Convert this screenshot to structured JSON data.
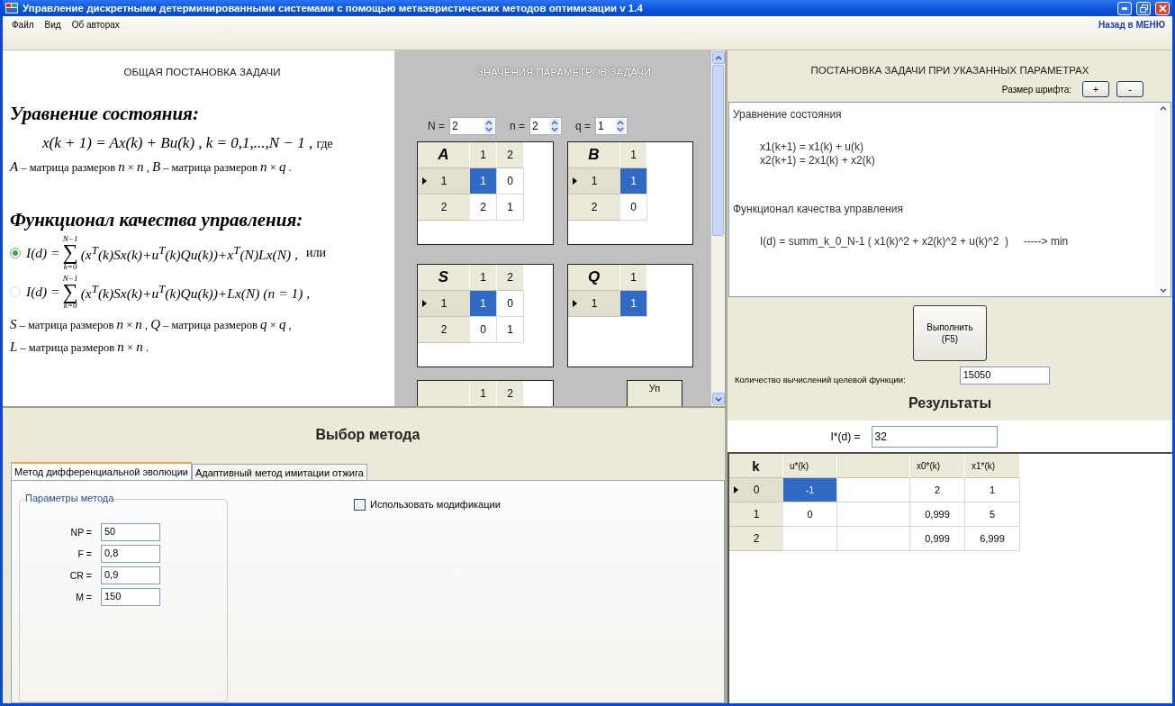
{
  "window": {
    "title": "Управление дискретными детерминированными системами с помощью метаэвристических методов оптимизации v 1.4"
  },
  "menu": {
    "items": [
      "Файл",
      "Вид",
      "Об авторах"
    ],
    "back_link": "Назад в МЕНЮ"
  },
  "general_statement": {
    "title": "ОБЩАЯ ПОСТАНОВКА ЗАДАЧИ",
    "state_heading": "Уравнение состояния:",
    "state_equation": "x(k + 1) = Ax(k) + Bu(k) ,  k = 0,1,...,N − 1 ,",
    "state_suffix": "где",
    "state_note": "*A* – матрица размеров *n* × *n* ,  *B* – матрица размеров *n* × *q* .",
    "functional_heading": "Функционал качества управления:",
    "functional_options": [
      {
        "selected": true,
        "prefix": "I(d) =",
        "upper": "N−1",
        "symbol": "∑",
        "lower": "k=0",
        "body": "(x$^{T}$(k)Sx(k)+u$^{T}$(k)Qu(k))+x$^{T}$(N)Lx(N) ,",
        "suffix": "или"
      },
      {
        "selected": false,
        "prefix": "I(d) =",
        "upper": "N−1",
        "symbol": "∑",
        "lower": "k=0",
        "body": "(x$^{T}$(k)Sx(k)+u$^{T}$(k)Qu(k))+Lx(N)   (n = 1) ,"
      }
    ],
    "notes": [
      "*S* – матрица размеров *n* × *n* ,  *Q* – матрица размеров *q* × *q* ,",
      "*L* – матрица размеров *n* × *n* ."
    ]
  },
  "parameters": {
    "title": "ЗНАЧЕНИЯ ПАРАМЕТРОВ ЗАДАЧИ",
    "spinners": [
      {
        "label": "N =",
        "value": "2"
      },
      {
        "label": "n =",
        "value": "2"
      },
      {
        "label": "q =",
        "value": "1"
      }
    ],
    "matrices": [
      {
        "name": "A",
        "columns": [
          "1",
          "2"
        ],
        "rows": [
          {
            "label": "1",
            "current": true,
            "cells": [
              {
                "value": "1",
                "selected": true
              },
              {
                "value": "0",
                "selected": false
              }
            ]
          },
          {
            "label": "2",
            "current": false,
            "cells": [
              {
                "value": "2",
                "selected": false
              },
              {
                "value": "1",
                "selected": false
              }
            ]
          }
        ]
      },
      {
        "name": "B",
        "columns": [
          "1"
        ],
        "rows": [
          {
            "label": "1",
            "current": true,
            "cells": [
              {
                "value": "1",
                "selected": true
              }
            ]
          },
          {
            "label": "2",
            "current": false,
            "cells": [
              {
                "value": "0",
                "selected": false
              }
            ]
          }
        ]
      },
      {
        "name": "S",
        "columns": [
          "1",
          "2"
        ],
        "rows": [
          {
            "label": "1",
            "current": true,
            "cells": [
              {
                "value": "1",
                "selected": true
              },
              {
                "value": "0",
                "selected": false
              }
            ]
          },
          {
            "label": "2",
            "current": false,
            "cells": [
              {
                "value": "0",
                "selected": false
              },
              {
                "value": "1",
                "selected": false
              }
            ]
          }
        ]
      },
      {
        "name": "Q",
        "columns": [
          "1"
        ],
        "rows": [
          {
            "label": "1",
            "current": true,
            "cells": [
              {
                "value": "1",
                "selected": true
              }
            ]
          }
        ]
      }
    ],
    "partial_matrix": {
      "columns": [
        "1",
        "2"
      ]
    },
    "partial_button": "Уп"
  },
  "specific_statement": {
    "title": "ПОСТАНОВКА ЗАДАЧИ ПРИ УКАЗАННЫХ ПАРАМЕТРАХ",
    "font_size_label": "Размер шрифта:",
    "font_buttons": [
      "+",
      "-"
    ],
    "lines": [
      {
        "kind": "heading",
        "text": "Уравнение состояния"
      },
      {
        "kind": "formula",
        "text": "x1(k+1) = x1(k) + u(k)"
      },
      {
        "kind": "formula",
        "text": "x2(k+1) = 2x1(k) + x2(k)"
      },
      {
        "kind": "heading",
        "text": "Функционал качества управления"
      },
      {
        "kind": "formula",
        "text": "I(d) = summ_k_0_N-1 ( x1(k)^2 + x2(k)^2 + u(k)^2  )     -----> min"
      }
    ]
  },
  "run_button": {
    "lines": [
      "Выполнить",
      "(F5)"
    ]
  },
  "evaluations": {
    "label": "Количество вычислений целевой функции:",
    "value": "15050"
  },
  "results": {
    "title": "Результаты",
    "objective_label": "I*(d) =",
    "objective_value": "32",
    "columns": [
      {
        "label": "k"
      },
      {
        "label": "u*(k)"
      },
      {},
      {
        "label": "x0*(k)"
      },
      {
        "label": "x1*(k)"
      }
    ],
    "rows": [
      {
        "current": true,
        "cells": [
          {
            "value": "0"
          },
          {
            "value": "-1",
            "selected": true
          },
          {
            "selected": false
          },
          {
            "value": "2",
            "selected": false
          },
          {
            "value": "1",
            "selected": false
          }
        ]
      },
      {
        "current": false,
        "cells": [
          {
            "value": "1"
          },
          {
            "value": "0",
            "selected": false
          },
          {
            "selected": false
          },
          {
            "value": "0,999",
            "selected": false
          },
          {
            "value": "5",
            "selected": false
          }
        ]
      },
      {
        "current": false,
        "cells": [
          {
            "value": "2"
          },
          {
            "selected": false
          },
          {
            "selected": false
          },
          {
            "value": "0,999",
            "selected": false
          },
          {
            "value": "6,999",
            "selected": false
          }
        ]
      }
    ]
  },
  "method": {
    "title": "Выбор метода",
    "tabs": [
      {
        "label": "Метод дифференциальной эволюции",
        "selected": true
      },
      {
        "label": "Адаптивный метод имитации отжига",
        "selected": false
      }
    ],
    "group_title": "Параметры метода",
    "params": [
      {
        "label": "NP =",
        "value": "50"
      },
      {
        "label": "F =",
        "value": "0,8"
      },
      {
        "label": "CR =",
        "value": "0,9"
      },
      {
        "label": "M =",
        "value": "150"
      }
    ],
    "checkbox": {
      "label": "Использовать модификации",
      "checked": false
    }
  }
}
